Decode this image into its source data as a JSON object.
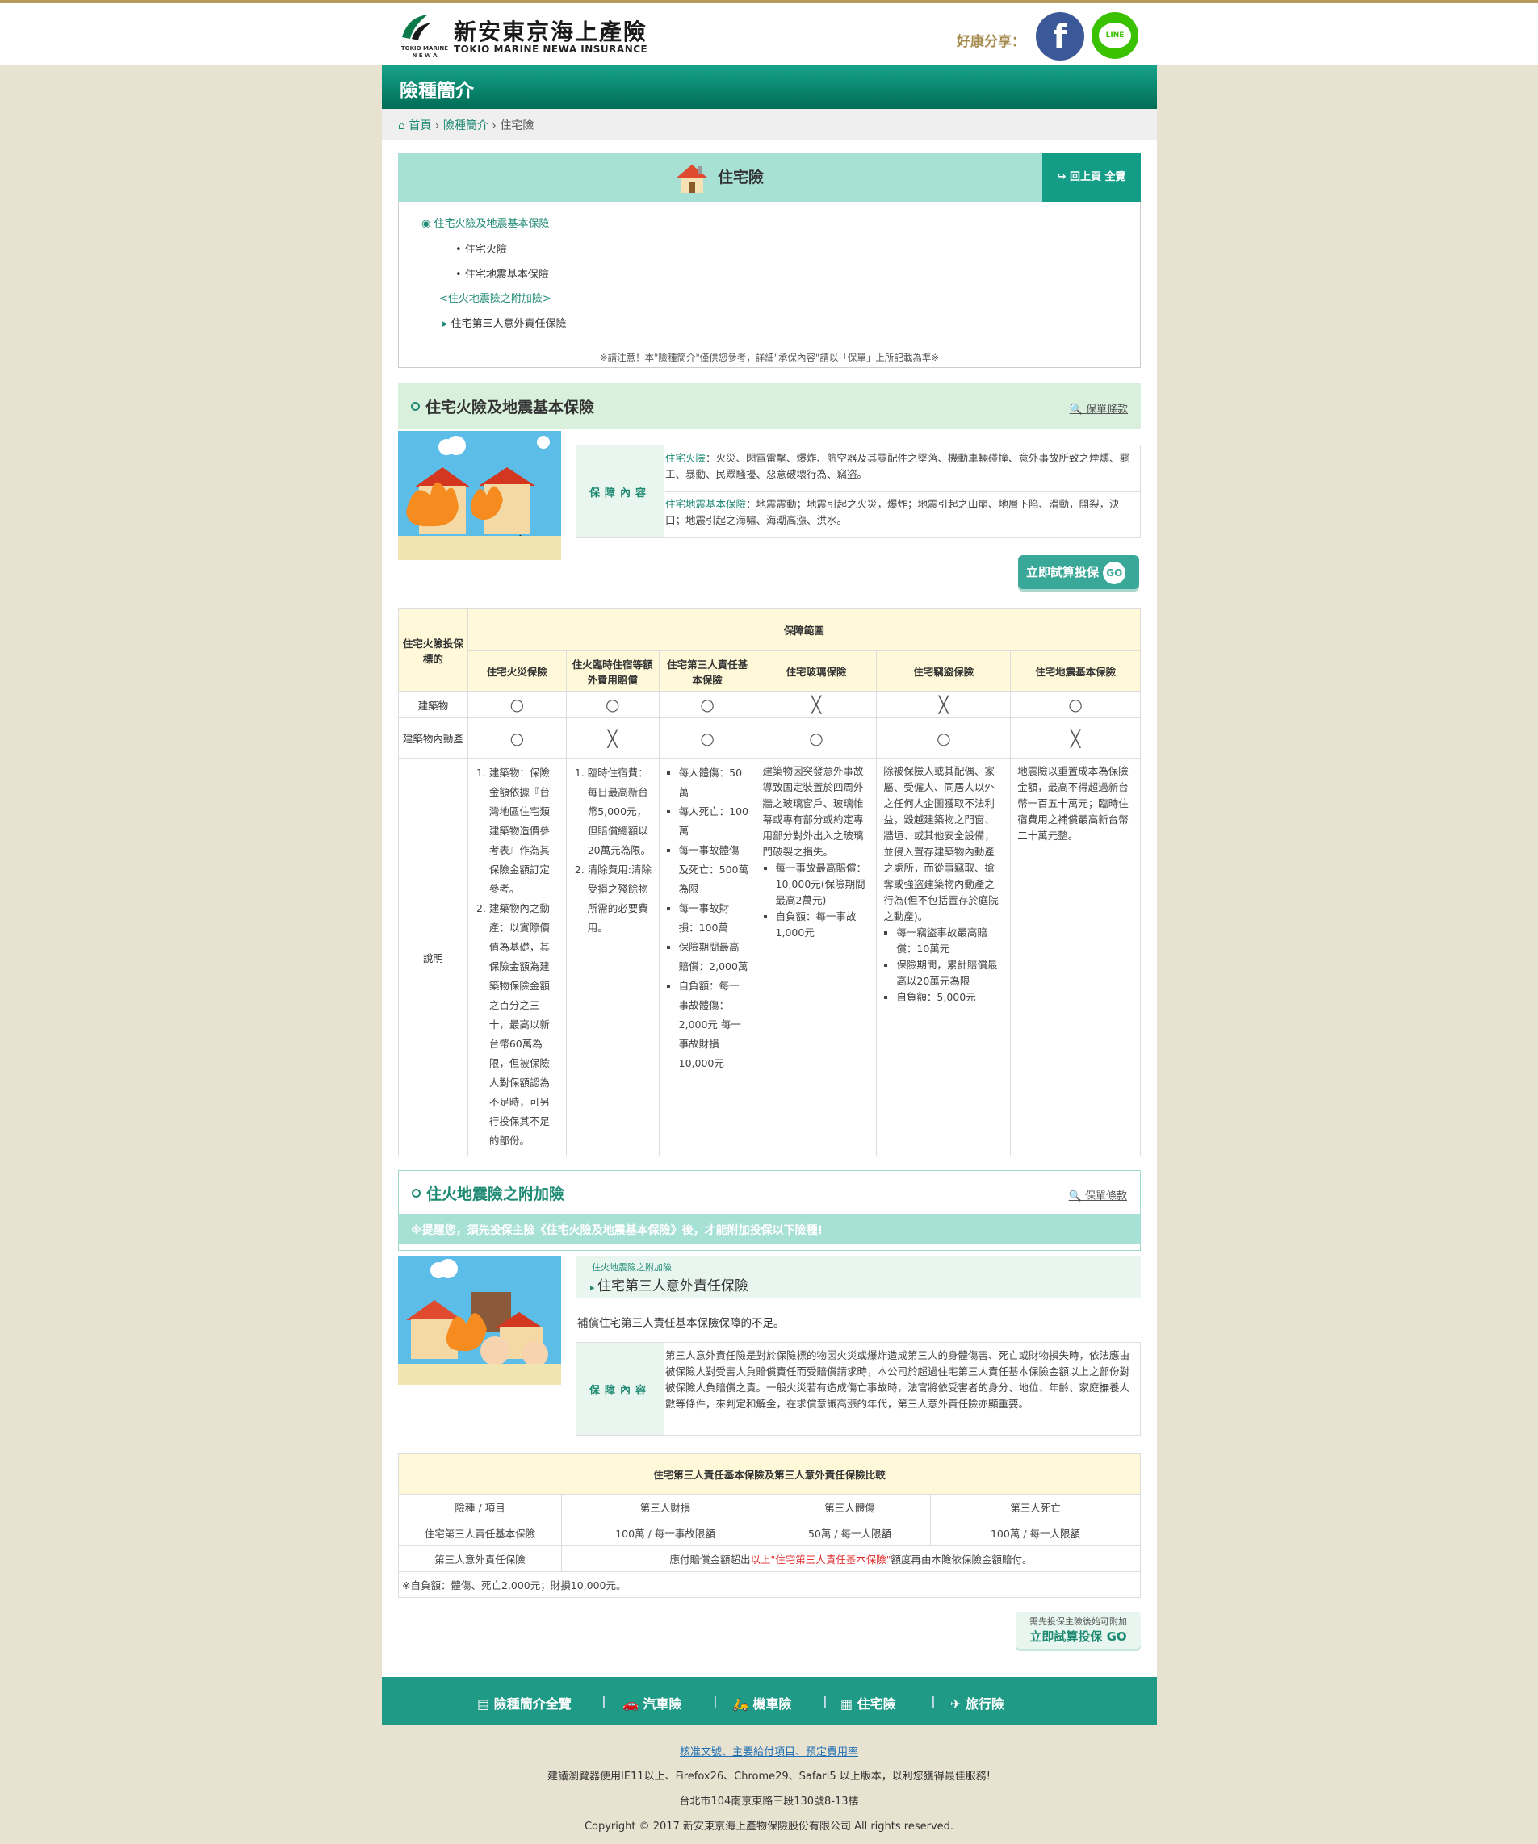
{
  "header": {
    "company_zh": "新安東京海上產險",
    "company_en": "TOKIO MARINE NEWA INSURANCE",
    "logo_small": "TOKIO MARINE N E W A",
    "share_label": "好康分享：",
    "facebook_icon": "f",
    "line_icon": "LINE"
  },
  "page_title": "險種簡介",
  "breadcrumb": [
    "首頁",
    "險種簡介",
    "住宅險"
  ],
  "hero": {
    "title": "住宅險",
    "back_label": "回上頁 全覽"
  },
  "menu": {
    "main": "住宅火險及地震基本保險",
    "sub1": "住宅火險",
    "sub2": "住宅地震基本保險",
    "rider_head": "<住火地震險之附加險>",
    "rider1": "住宅第三人意外責任保險",
    "note": "※請注意！本\"險種簡介\"僅供您參考，詳細\"承保內容\"請以「保單」上所記載為準※"
  },
  "section1": {
    "title": "住宅火險及地震基本保險",
    "terms": "保單條款",
    "coverage_label": "保障內容",
    "fire_name": "住宅火險",
    "fire_text": "：火災、閃電雷擊、爆炸、航空器及其零配件之墜落、機動車輛碰撞、意外事故所致之煙燻、罷工、暴動、民眾騷擾、惡意破壞行為、竊盜。",
    "quake_name": "住宅地震基本保險",
    "quake_text": "：地震震動；地震引起之火災，爆炸；地震引起之山崩、地層下陷、滑動，開裂，決口；地震引起之海嘯、海潮高漲、洪水。",
    "quote_btn": "立即試算投保",
    "go": "GO"
  },
  "table1": {
    "corner": "住宅火險投保標的",
    "span_header": "保障範圍",
    "cols": [
      "住宅火災保險",
      "住火臨時住宿等額外費用賠償",
      "住宅第三人責任基本保險",
      "住宅玻璃保險",
      "住宅竊盜保險",
      "住宅地震基本保險"
    ],
    "row1_label": "建築物",
    "row1": [
      "○",
      "○",
      "○",
      "╳",
      "╳",
      "○"
    ],
    "row2_label": "建築物內動產",
    "row2": [
      "○",
      "╳",
      "○",
      "○",
      "○",
      "╳"
    ],
    "desc_label": "說明",
    "d1": [
      "建築物：保險金額依據『台灣地區住宅類建築物造價參考表』作為其保險金額訂定參考。",
      "建築物內之動產：以實際價值為基礎，其保險金額為建築物保險金額之百分之三十，最高以新台幣60萬為限，但被保險人對保額認為不足時，可另行投保其不足的部份。"
    ],
    "d2": [
      "臨時住宿費：每日最高新台幣5,000元，但賠償總額以20萬元為限。",
      "清除費用:清除受損之殘餘物所需的必要費用。"
    ],
    "d3": [
      "每人體傷：50萬",
      "每人死亡：100萬",
      "每一事故體傷及死亡：500萬為限",
      "每一事故財損：100萬",
      "保險期間最高賠償：2,000萬",
      "自負額：每一事故體傷：2,000元 每一事故財損10,000元"
    ],
    "d4_text": "建築物因突發意外事故導致固定裝置於四周外牆之玻璃窗戶、玻璃帷幕或專有部分或約定專用部分對外出入之玻璃門破裂之損失。",
    "d4": [
      "每一事故最高賠償：10,000元(保險期間最高2萬元)",
      "自負額：每一事故1,000元"
    ],
    "d5_text": "除被保險人或其配偶、家屬、受僱人、同居人以外之任何人企圖獲取不法利益，毀越建築物之門窗、牆垣、或其他安全設備，並侵入置存建築物內動產之處所，而從事竊取、搶奪或強盜建築物內動產之行為(但不包括置存於庭院之動產)。",
    "d5": [
      "每一竊盜事故最高賠償：10萬元",
      "保險期間，累計賠償最高以20萬元為限",
      "自負額：5,000元"
    ],
    "d6_text": "地震險以重置成本為保險金額，最高不得超過新台幣一百五十萬元；臨時住宿費用之補償最高新台幣二十萬元整。"
  },
  "section2": {
    "title": "住火地震險之附加險",
    "terms": "保單條款",
    "notice": "※提醒您，須先投保主險《住宅火險及地震基本保險》後，才能附加投保以下險種!",
    "small_title": "住火地震險之附加險",
    "product": "住宅第三人意外責任保險",
    "summary": "補償住宅第三人責任基本保險保障的不足。",
    "coverage_label": "保障內容",
    "coverage_text": "第三人意外責任險是對於保險標的物因火災或爆炸造成第三人的身體傷害、死亡或財物損失時，依法應由被保險人對受害人負賠償責任而受賠償請求時，本公司於超過住宅第三人責任基本保險金額以上之部份對被保險人負賠償之責。一般火災若有造成傷亡事故時，法官將依受害者的身分、地位、年齡、家庭撫養人數等條件，來判定和解金，在求償意識高漲的年代，第三人意外責任險亦顯重要。"
  },
  "table2": {
    "title": "住宅第三人責任基本保險及第三人意外責任保險比較",
    "headers": [
      "險種 / 項目",
      "第三人財損",
      "第三人體傷",
      "第三人死亡"
    ],
    "r1": [
      "住宅第三人責任基本保險",
      "100萬 / 每一事故限額",
      "50萬 / 每一人限額",
      "100萬 / 每一人限額"
    ],
    "r2_label": "第三人意外責任保險",
    "r2_a": "應付賠償金額超出",
    "r2_b": "以上\"住宅第三人責任基本保險\"",
    "r2_c": "額度再由本險依保險金額賠付。",
    "note": "※自負額：體傷、死亡2,000元；財損10,000元。"
  },
  "bottom_btn": {
    "top": "需先投保主險後始可附加",
    "main": "立即試算投保 GO"
  },
  "footer_nav": [
    "險種簡介全覽",
    "汽車險",
    "機車險",
    "住宅險",
    "旅行險"
  ],
  "footer": {
    "links": "核准文號、主要給付項目、預定費用率",
    "browser": "建議瀏覽器使用IE11以上、Firefox26、Chrome29、Safari5 以上版本，以利您獲得最佳服務!",
    "address": "台北市104南京東路三段130號8-13樓",
    "copyright": "Copyright © 2017 新安東京海上產物保險股份有限公司 All rights reserved."
  }
}
